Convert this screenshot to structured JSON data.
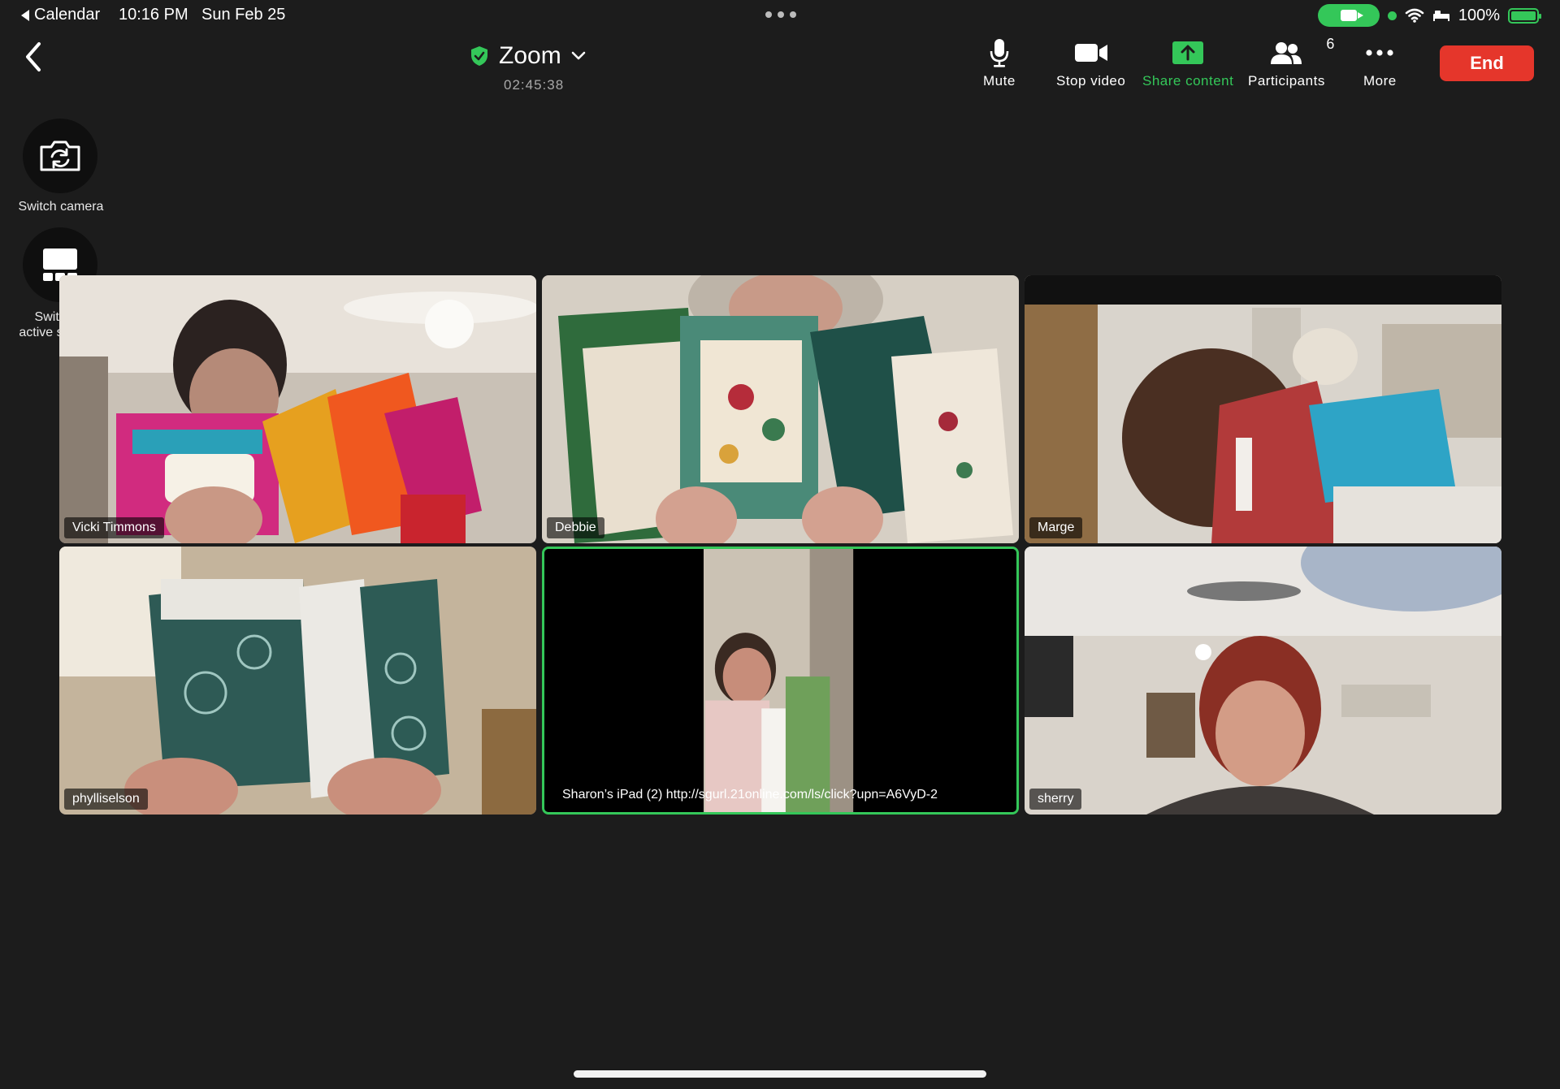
{
  "status_bar": {
    "back_app": "Calendar",
    "time": "10:16 PM",
    "date": "Sun Feb 25",
    "battery": "100%"
  },
  "meeting": {
    "title": "Zoom",
    "timer": "02:45:38"
  },
  "toolbar": {
    "mute": "Mute",
    "stop_video": "Stop video",
    "share_content": "Share content",
    "participants": "Participants",
    "participants_count": "6",
    "more": "More",
    "end": "End"
  },
  "side_controls": {
    "switch_camera": "Switch camera",
    "switch_active_speaker_line1": "Switch to",
    "switch_active_speaker_line2": "active speaker"
  },
  "participants": [
    {
      "name": "Vicki Timmons"
    },
    {
      "name": "Debbie"
    },
    {
      "name": "Marge"
    },
    {
      "name": "phylliselson"
    },
    {
      "name": "Sharon’s iPad (2) http://sgurl.21online.com/ls/click?upn=A6VyD-2",
      "active": true
    },
    {
      "name": "sherry"
    }
  ],
  "colors": {
    "accent_green": "#34c759",
    "end_red": "#e5362b",
    "background": "#1c1c1c"
  }
}
